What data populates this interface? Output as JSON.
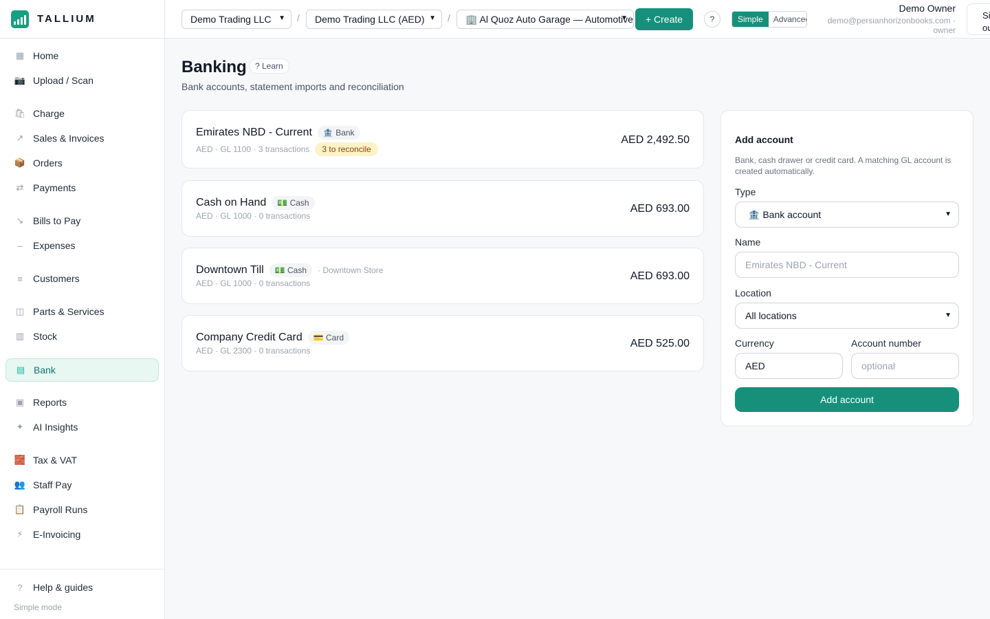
{
  "brand": {
    "name": "TALLIUM",
    "color": "#16a07f"
  },
  "sidebar": {
    "items": [
      {
        "label": "Home",
        "icon": "grid-icon",
        "glyph": "▦"
      },
      {
        "label": "Upload / Scan",
        "icon": "camera-icon",
        "glyph": "📷"
      },
      {
        "label": "Charge",
        "icon": "shopping-bag-icon",
        "glyph": "🛍"
      },
      {
        "label": "Sales & Invoices",
        "icon": "arrow-up-right-icon",
        "glyph": "↗"
      },
      {
        "label": "Orders",
        "icon": "package-icon",
        "glyph": "📦"
      },
      {
        "label": "Payments",
        "icon": "swap-arrows-icon",
        "glyph": "⇄"
      },
      {
        "label": "Bills to Pay",
        "icon": "arrow-down-right-icon",
        "glyph": "↘"
      },
      {
        "label": "Expenses",
        "icon": "minus-icon",
        "glyph": "–"
      },
      {
        "label": "Customers",
        "icon": "list-icon",
        "glyph": "≡"
      },
      {
        "label": "Parts & Services",
        "icon": "columns-icon",
        "glyph": "◫"
      },
      {
        "label": "Stock",
        "icon": "stock-icon",
        "glyph": "▥"
      },
      {
        "label": "Bank",
        "icon": "bank-icon",
        "glyph": "▤"
      },
      {
        "label": "Reports",
        "icon": "report-icon",
        "glyph": "▣"
      },
      {
        "label": "AI Insights",
        "icon": "sparkle-icon",
        "glyph": "✦"
      },
      {
        "label": "Tax & VAT",
        "icon": "tax-icon",
        "glyph": "🧱"
      },
      {
        "label": "Staff Pay",
        "icon": "people-icon",
        "glyph": "👥"
      },
      {
        "label": "Payroll Runs",
        "icon": "clipboard-icon",
        "glyph": "📋"
      },
      {
        "label": "E-Invoicing",
        "icon": "lightning-icon",
        "glyph": "⚡"
      }
    ],
    "active_index": 11,
    "help_label": "Help & guides",
    "mode_note": "Simple mode"
  },
  "topbar": {
    "company": "Demo Trading LLC",
    "ledger": "Demo Trading LLC (AED)",
    "location": "🏢 Al Quoz Auto Garage — Automotive",
    "create_label": "+ Create",
    "help_label": "?",
    "mode_simple": "Simple",
    "mode_advanced": "Advanced",
    "user_name": "Demo Owner",
    "user_email": "demo@persianhorizonbooks.com ·",
    "user_role": "owner",
    "signout_label": "Sign out"
  },
  "page": {
    "title": "Banking",
    "learn": "? Learn",
    "subtitle": "Bank accounts, statement imports and reconciliation"
  },
  "accounts": [
    {
      "name": "Emirates NBD - Current",
      "badge": "🏦 Bank",
      "location": "",
      "meta": "AED · GL 1100 · 3 transactions",
      "reconcile": "3 to reconcile",
      "balance": "AED 2,492.50"
    },
    {
      "name": "Cash on Hand",
      "badge": "💵 Cash",
      "location": "",
      "meta": "AED · GL 1000 · 0 transactions",
      "reconcile": "",
      "balance": "AED 693.00"
    },
    {
      "name": "Downtown Till",
      "badge": "💵 Cash",
      "location": "· Downtown Store",
      "meta": "AED · GL 1000 · 0 transactions",
      "reconcile": "",
      "balance": "AED 693.00"
    },
    {
      "name": "Company Credit Card",
      "badge": "💳 Card",
      "location": "",
      "meta": "AED · GL 2300 · 0 transactions",
      "reconcile": "",
      "balance": "AED 525.00"
    }
  ],
  "form": {
    "title": "Add account",
    "description": "Bank, cash drawer or credit card. A matching GL account is created automatically.",
    "type_label": "Type",
    "type_value": "🏦 Bank account",
    "name_label": "Name",
    "name_placeholder": "Emirates NBD - Current",
    "location_label": "Location",
    "location_value": "All locations",
    "currency_label": "Currency",
    "currency_value": "AED",
    "account_number_label": "Account number",
    "account_number_placeholder": "optional",
    "submit_label": "Add account"
  },
  "colors": {
    "accent": "#16907a",
    "active_bg": "#e8f7f2",
    "reconcile_bg": "#fef3c7"
  }
}
